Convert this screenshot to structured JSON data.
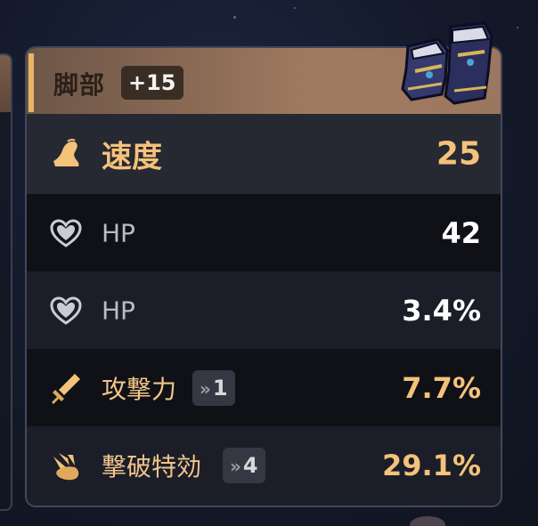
{
  "relic": {
    "slot": "脚部",
    "level": "+15",
    "main_stat": {
      "label": "速度",
      "value": "25",
      "icon": "speed-icon"
    },
    "sub_stats": [
      {
        "label": "HP",
        "value": "42",
        "icon": "hp-heart-icon",
        "rolls": null
      },
      {
        "label": "HP",
        "value": "3.4%",
        "icon": "hp-heart-icon",
        "rolls": null
      },
      {
        "label": "攻撃力",
        "value": "7.7%",
        "icon": "atk-sword-icon",
        "rolls": "1"
      },
      {
        "label": "撃破特効",
        "value": "29.1%",
        "icon": "break-effect-icon",
        "rolls": "4"
      }
    ]
  },
  "colors": {
    "accent_gold": "#f5c27a",
    "header_brown": "#8a6a55",
    "row_dark": "#0f1117",
    "row_mid": "#1b1e28"
  }
}
